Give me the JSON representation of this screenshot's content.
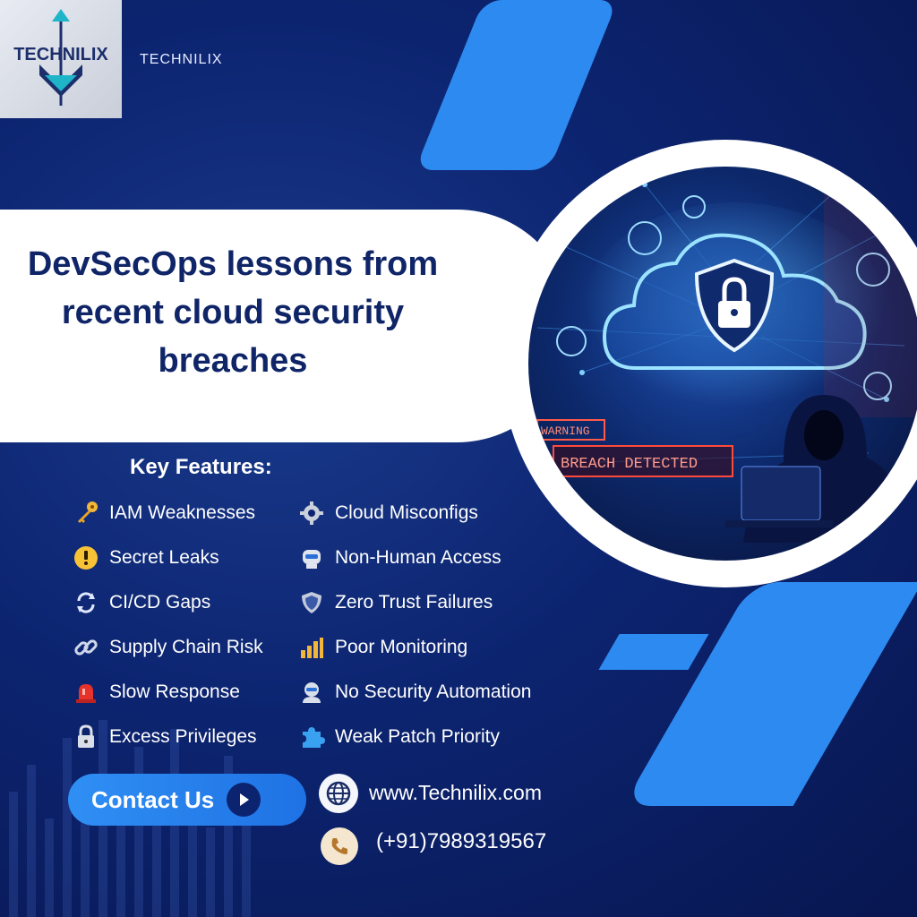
{
  "brand": {
    "logo_text": "TECHNILIX",
    "name": "TECHNILIX"
  },
  "title": "DevSecOps lessons from recent cloud security breaches",
  "illustration": {
    "warning_text": "WARNING",
    "breach_text": "BREACH DETECTED"
  },
  "features": {
    "heading": "Key Features:",
    "left": [
      {
        "label": "IAM Weaknesses",
        "icon": "key-icon"
      },
      {
        "label": "Secret Leaks",
        "icon": "alert-icon"
      },
      {
        "label": "CI/CD Gaps",
        "icon": "cycle-icon"
      },
      {
        "label": "Supply Chain Risk",
        "icon": "chain-link-icon"
      },
      {
        "label": "Slow Response",
        "icon": "siren-icon"
      },
      {
        "label": "Excess Privileges",
        "icon": "padlock-icon"
      }
    ],
    "right": [
      {
        "label": "Cloud Misconfigs",
        "icon": "gear-icon"
      },
      {
        "label": "Non-Human Access",
        "icon": "robot-icon"
      },
      {
        "label": "Zero Trust Failures",
        "icon": "shield-icon"
      },
      {
        "label": "Poor Monitoring",
        "icon": "bar-chart-icon"
      },
      {
        "label": "No Security Automation",
        "icon": "bot-icon"
      },
      {
        "label": "Weak Patch Priority",
        "icon": "puzzle-icon"
      }
    ]
  },
  "contact": {
    "button_label": "Contact Us",
    "website": "www.Technilix.com",
    "phone": "(+91)7989319567"
  },
  "colors": {
    "background": "#0c2470",
    "accent": "#2d8af0",
    "title_text": "#0f2567"
  }
}
